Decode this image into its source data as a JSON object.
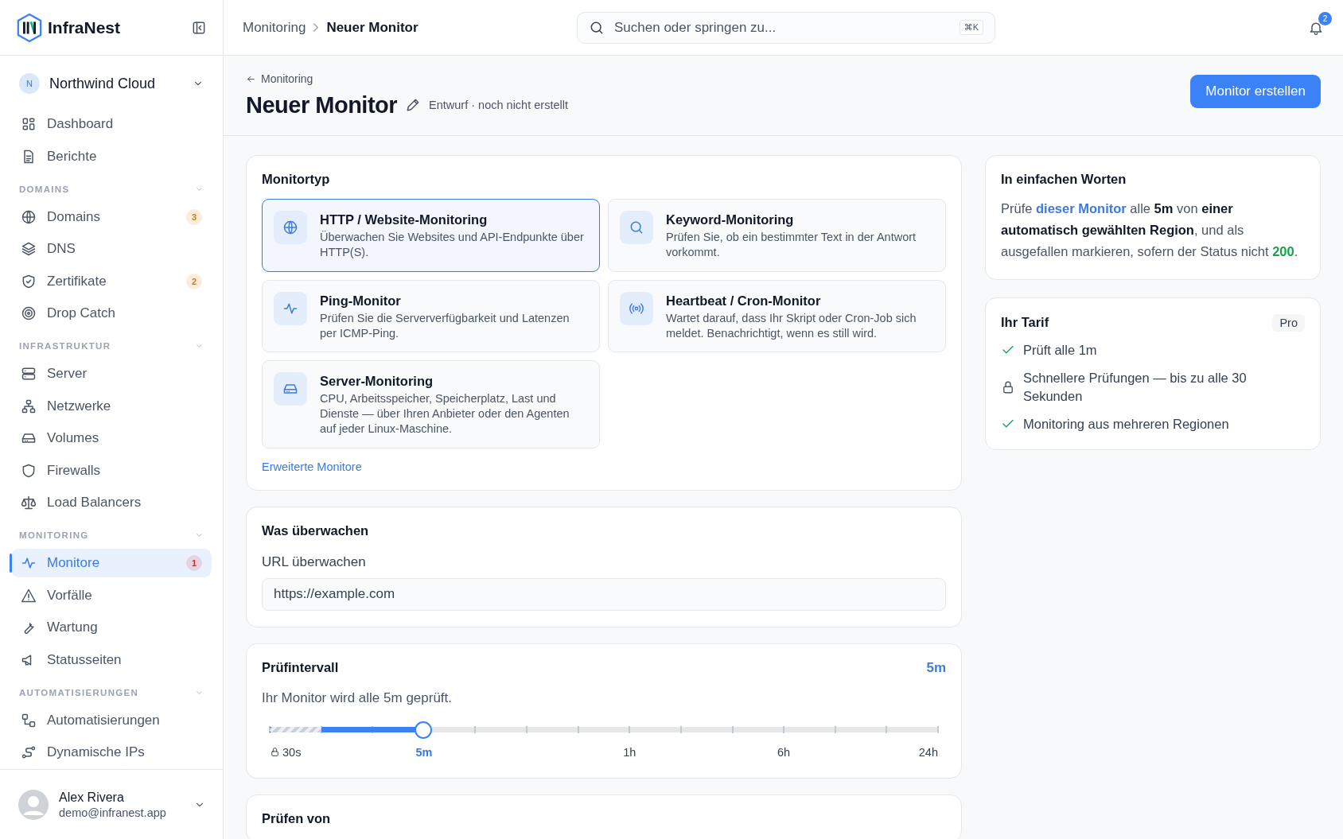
{
  "sidebar": {
    "brand": "InfraNest",
    "org": {
      "initial": "N",
      "name": "Northwind Cloud"
    },
    "sections": [
      {
        "items": [
          {
            "label": "Dashboard",
            "selected": false
          },
          {
            "label": "Berichte",
            "selected": false
          }
        ]
      },
      {
        "title": "DOMAINS",
        "items": [
          {
            "label": "Domains",
            "selected": false,
            "badge": "3",
            "color": "#d97706"
          },
          {
            "label": "DNS",
            "selected": false
          },
          {
            "label": "Zertifikate",
            "selected": false,
            "badge": "2",
            "color": "#d97706"
          },
          {
            "label": "Drop Catch",
            "selected": false
          }
        ]
      },
      {
        "title": "INFRASTRUKTUR",
        "items": [
          {
            "label": "Server",
            "selected": false
          },
          {
            "label": "Netzwerke",
            "selected": false
          },
          {
            "label": "Volumes",
            "selected": false
          },
          {
            "label": "Firewalls",
            "selected": false
          },
          {
            "label": "Load Balancers",
            "selected": false
          }
        ]
      },
      {
        "title": "MONITORING",
        "items": [
          {
            "label": "Monitore",
            "selected": true,
            "badge": "1",
            "color": "#dc2626"
          },
          {
            "label": "Vorfälle",
            "selected": false
          },
          {
            "label": "Wartung",
            "selected": false
          },
          {
            "label": "Statusseiten",
            "selected": false
          }
        ]
      },
      {
        "title": "AUTOMATISIERUNGEN",
        "items": [
          {
            "label": "Automatisierungen",
            "selected": false
          },
          {
            "label": "Dynamische IPs",
            "selected": false
          }
        ]
      }
    ],
    "user": {
      "name": "Alex Rivera",
      "email": "demo@infranest.app"
    }
  },
  "topbar": {
    "breadcrumb": [
      "Monitoring",
      "Neuer Monitor"
    ],
    "search": {
      "placeholder": "Suchen oder springen zu...",
      "shortcut": "⌘K"
    },
    "notifications": "2"
  },
  "page_header": {
    "back": "Monitoring",
    "title": "Neuer Monitor",
    "status": "Entwurf · noch nicht erstellt",
    "primary_button": "Monitor erstellen"
  },
  "monitor_type": {
    "title": "Monitortyp",
    "options": [
      {
        "title": "HTTP / Website-Monitoring",
        "description": "Überwachen Sie Websites und API-Endpunkte über HTTP(S).",
        "selected": true
      },
      {
        "title": "Keyword-Monitoring",
        "description": "Prüfen Sie, ob ein bestimmter Text in der Antwort vorkommt.",
        "selected": false
      },
      {
        "title": "Ping-Monitor",
        "description": "Prüfen Sie die Serververfügbarkeit und Latenzen per ICMP-Ping.",
        "selected": false
      },
      {
        "title": "Heartbeat / Cron-Monitor",
        "description": "Wartet darauf, dass Ihr Skript oder Cron-Job sich meldet. Benachrichtigt, wenn es still wird.",
        "selected": false
      },
      {
        "title": "Server-Monitoring",
        "description": "CPU, Arbeitsspeicher, Speicherplatz, Last und Dienste — über Ihren Anbieter oder den Agenten auf jeder Linux-Maschine.",
        "selected": false
      }
    ],
    "more_link": "Erweiterte Monitore"
  },
  "watch": {
    "title": "Was überwachen",
    "field_label": "URL überwachen",
    "value": "https://example.com"
  },
  "interval": {
    "title": "Prüfintervall",
    "current": "5m",
    "description": "Ihr Monitor wird alle 5m geprüft.",
    "level": 0.23,
    "scale": [
      {
        "label": "30s",
        "locked": true,
        "selected": false
      },
      {
        "label": "5m",
        "locked": false,
        "selected": true
      },
      {
        "label": "1h",
        "locked": false,
        "selected": false
      },
      {
        "label": "6h",
        "locked": false,
        "selected": false
      },
      {
        "label": "24h",
        "locked": false,
        "selected": false
      }
    ]
  },
  "check_from": {
    "title": "Prüfen von"
  },
  "summary": {
    "title": "In einfachen Worten",
    "parts": [
      {
        "kind": "text",
        "text": "Prüfe "
      },
      {
        "kind": "link",
        "text": "dieser Monitor"
      },
      {
        "kind": "text",
        "text": " alle "
      },
      {
        "kind": "bold",
        "text": "5m"
      },
      {
        "kind": "text",
        "text": " von "
      },
      {
        "kind": "bold",
        "text": "einer automatisch gewählten Region"
      },
      {
        "kind": "text",
        "text": ", und als ausgefallen markieren, sofern der Status nicht "
      },
      {
        "kind": "status",
        "text": "200"
      },
      {
        "kind": "text",
        "text": "."
      }
    ]
  },
  "plan": {
    "title": "Ihr Tarif",
    "badge": "Pro",
    "features": [
      {
        "text": "Prüft alle 1m",
        "included": true
      },
      {
        "text": "Schnellere Prüfungen — bis zu alle 30 Sekunden",
        "included": false
      },
      {
        "text": "Monitoring aus mehreren Regionen",
        "included": true
      }
    ]
  }
}
